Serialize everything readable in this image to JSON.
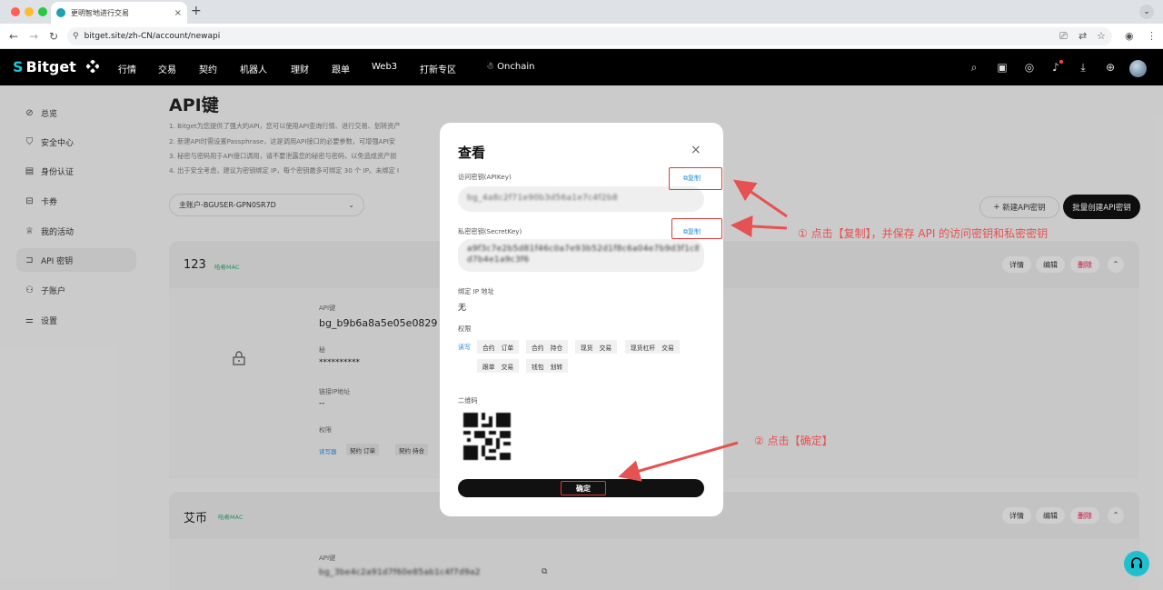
{
  "browser": {
    "tab_title": "更明智地进行交易",
    "tab_close": "×",
    "new_tab": "+",
    "url": "bitget.site/zh-CN/account/newapi"
  },
  "header": {
    "logo": "Bitget",
    "nav": [
      "行情",
      "交易",
      "契约",
      "机器人",
      "理财",
      "跟单",
      "Web3",
      "打新专区",
      "Onchain"
    ]
  },
  "sidebar": {
    "items": [
      {
        "label": "总览",
        "icon": "compass-icon"
      },
      {
        "label": "安全中心",
        "icon": "shield-icon"
      },
      {
        "label": "身份认证",
        "icon": "id-card-icon"
      },
      {
        "label": "卡券",
        "icon": "ticket-icon"
      },
      {
        "label": "我的活动",
        "icon": "trophy-icon"
      },
      {
        "label": "API 密钥",
        "icon": "api-icon"
      },
      {
        "label": "子账户",
        "icon": "users-icon"
      },
      {
        "label": "设置",
        "icon": "sliders-icon"
      }
    ]
  },
  "page": {
    "title": "API键",
    "notes": [
      "1. Bitget为您提供了强大的API，您可以使用API查询行情、进行交易、划转资产",
      "2. 新建API时需设置Passphrase，这是调用API接口的必要参数，可增强API安",
      "3. 秘密与密码用于API接口调用，请不要泄露您的秘密与密码，以免造成资产损",
      "4. 出于安全考虑，建议为密钥绑定 IP，每个密钥最多可绑定 30 个 IP。未绑定 I"
    ],
    "account_select": "主账户-BGUSER-GPN0SR7D",
    "new_api_button": "新建API密钥",
    "bulk_button": "批量创建API密钥"
  },
  "cards": [
    {
      "name": "123",
      "badge": "哈希MAC",
      "actions": {
        "detail": "详情",
        "edit": "编辑",
        "delete": "删除"
      },
      "fields": {
        "api_key_label": "API键",
        "api_key_value": "bg_b9b6a8a5e05e0829",
        "secret_label": "秘",
        "secret_value": "**********",
        "ip_label": "链接IP地址",
        "ip_value": "--",
        "perm_label": "权限",
        "perm_rw": "读写器",
        "perms": [
          "契约 订单",
          "契约 持合"
        ]
      }
    },
    {
      "name": "艾币",
      "badge": "哈希MAC",
      "actions": {
        "detail": "详情",
        "edit": "编辑",
        "delete": "删除"
      },
      "fields": {
        "api_key_label": "API键",
        "api_key_value": "bg_3be4c2a91d7f60e85ab1c4f7d9a2"
      }
    }
  ],
  "modal": {
    "title": "查看",
    "close": "×",
    "access_key_label": "访问密钥(APIKey)",
    "access_key_value": "bg_4a8c2f71e90b3d56a1e7c4f2b8",
    "copy_label": "复制",
    "secret_key_label": "私密密钥(SecretKey)",
    "secret_key_value": "a9f3c7e2b5d81f46c0a7e93b52d1f8c6a04e7b9d3f1c8a52e6",
    "secret_key_value_2": "d7b4e1a9c3f6",
    "ip_label": "绑定 IP 地址",
    "ip_value": "无",
    "perm_label": "权限",
    "perm_rw": "读写",
    "perms_row1": [
      [
        "合约",
        "订单"
      ],
      [
        "合约",
        "持仓"
      ],
      [
        "现货",
        "交易"
      ],
      [
        "现货杠杆",
        "交易"
      ]
    ],
    "perms_row2": [
      [
        "跟单",
        "交易"
      ],
      [
        "钱包",
        "划转"
      ]
    ],
    "qr_label": "二维码",
    "confirm": "确定"
  },
  "annotations": {
    "step1": "① 点击【复制】，并保存 API 的访问密钥和私密密钥",
    "step2": "② 点击【确定】"
  },
  "colors": {
    "annotation": "#e23b3b",
    "accent": "#1ec8d8",
    "link": "#2a8fd6",
    "delete": "#ee1144"
  }
}
